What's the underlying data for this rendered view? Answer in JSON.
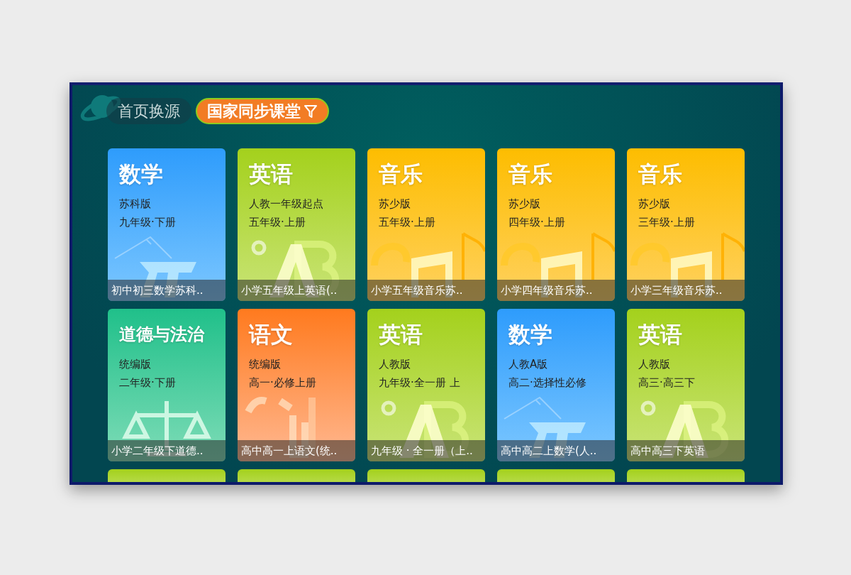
{
  "tabs": [
    {
      "label": "首页换源",
      "selected": false,
      "filter": false
    },
    {
      "label": "国家同步课堂",
      "selected": true,
      "filter": true
    }
  ],
  "courses": [
    {
      "kind": "math",
      "subject": "数学",
      "edition": "苏科版",
      "grade": "九年级·下册",
      "caption": "初中初三数学苏科.."
    },
    {
      "kind": "english",
      "subject": "英语",
      "edition": "人教一年级起点",
      "grade": "五年级·上册",
      "caption": "小学五年级上英语(.."
    },
    {
      "kind": "music",
      "subject": "音乐",
      "edition": "苏少版",
      "grade": "五年级·上册",
      "caption": "小学五年级音乐苏.."
    },
    {
      "kind": "music",
      "subject": "音乐",
      "edition": "苏少版",
      "grade": "四年级·上册",
      "caption": "小学四年级音乐苏.."
    },
    {
      "kind": "music",
      "subject": "音乐",
      "edition": "苏少版",
      "grade": "三年级·上册",
      "caption": "小学三年级音乐苏.."
    },
    {
      "kind": "morality",
      "subject": "道德与法治",
      "edition": "统编版",
      "grade": "二年级·下册",
      "caption": "小学二年级下道德.."
    },
    {
      "kind": "chinese",
      "subject": "语文",
      "edition": "统编版",
      "grade": "高一·必修上册",
      "caption": "高中高一上语文(统.."
    },
    {
      "kind": "english",
      "subject": "英语",
      "edition": "人教版",
      "grade": "九年级·全一册 上",
      "caption": "九年级 · 全一册（上.."
    },
    {
      "kind": "math",
      "subject": "数学",
      "edition": "人教A版",
      "grade": "高二·选择性必修",
      "caption": "高中高二上数学(人.."
    },
    {
      "kind": "english",
      "subject": "英语",
      "edition": "人教版",
      "grade": "高三·高三下",
      "caption": "高中高三下英语"
    }
  ],
  "partial_cards": [
    {
      "kind": "english"
    },
    {
      "kind": "english"
    },
    {
      "kind": "english"
    },
    {
      "kind": "english"
    },
    {
      "kind": "english"
    }
  ]
}
